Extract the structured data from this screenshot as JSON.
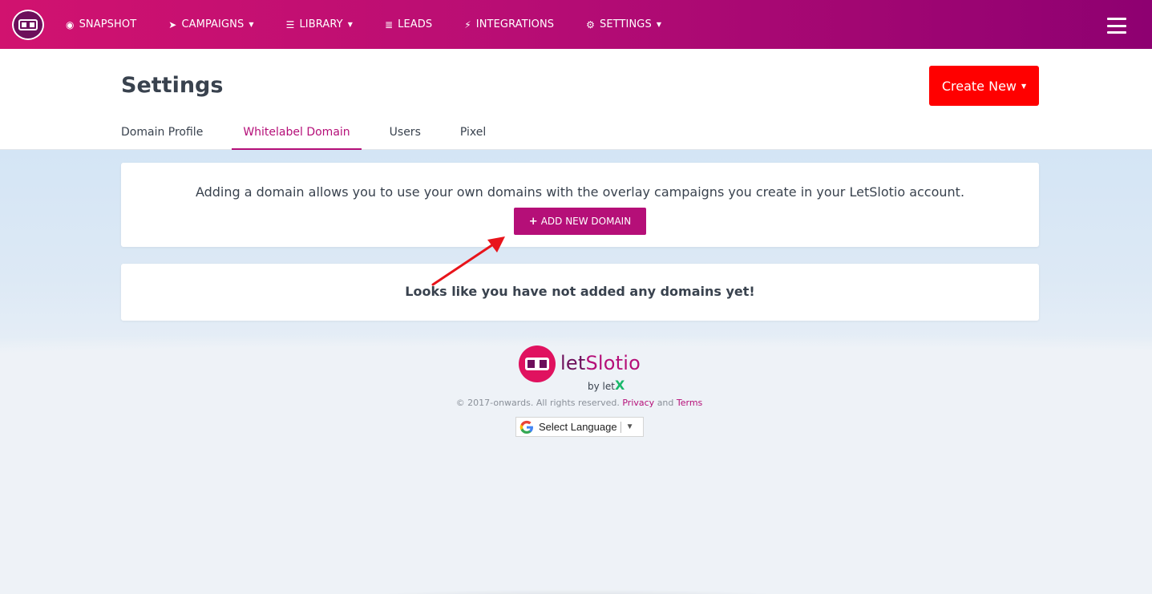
{
  "nav": {
    "items": [
      {
        "label": "SNAPSHOT",
        "icon": "dashboard-icon",
        "glyph": "◉",
        "has_caret": false
      },
      {
        "label": "CAMPAIGNS",
        "icon": "paper-plane-icon",
        "glyph": "➤",
        "has_caret": true
      },
      {
        "label": "LIBRARY",
        "icon": "library-icon",
        "glyph": "☰",
        "has_caret": true
      },
      {
        "label": "LEADS",
        "icon": "list-icon",
        "glyph": "≣",
        "has_caret": false
      },
      {
        "label": "INTEGRATIONS",
        "icon": "plug-icon",
        "glyph": "⚡",
        "has_caret": false
      },
      {
        "label": "SETTINGS",
        "icon": "gears-icon",
        "glyph": "⚙",
        "has_caret": true
      }
    ],
    "caret_glyph": "▼"
  },
  "header": {
    "title": "Settings",
    "create_label": "Create New",
    "caret_glyph": "▼"
  },
  "tabs": [
    {
      "label": "Domain Profile",
      "active": false
    },
    {
      "label": "Whitelabel Domain",
      "active": true
    },
    {
      "label": "Users",
      "active": false
    },
    {
      "label": "Pixel",
      "active": false
    }
  ],
  "domain_card": {
    "description": "Adding a domain allows you to use your own domains with the overlay campaigns you create in your LetSlotio account.",
    "add_button_label": "ADD NEW DOMAIN",
    "plus_glyph": "+"
  },
  "empty_card": {
    "message": "Looks like you have not added any domains yet!"
  },
  "footer": {
    "brand_let": "let",
    "brand_slotio": "Slotio",
    "by_text": "by let",
    "by_x": "X",
    "copyright_prefix": "© 2017-onwards. All rights reserved.",
    "privacy_label": "Privacy",
    "and_text": "and",
    "terms_label": "Terms",
    "language_label": "Select Language",
    "dropdown_glyph": "▼"
  },
  "colors": {
    "nav_start": "#d1126f",
    "nav_end": "#8e0071",
    "brand": "#b50f78",
    "create_button": "#ff0000",
    "annotation_arrow": "#e8141b"
  }
}
